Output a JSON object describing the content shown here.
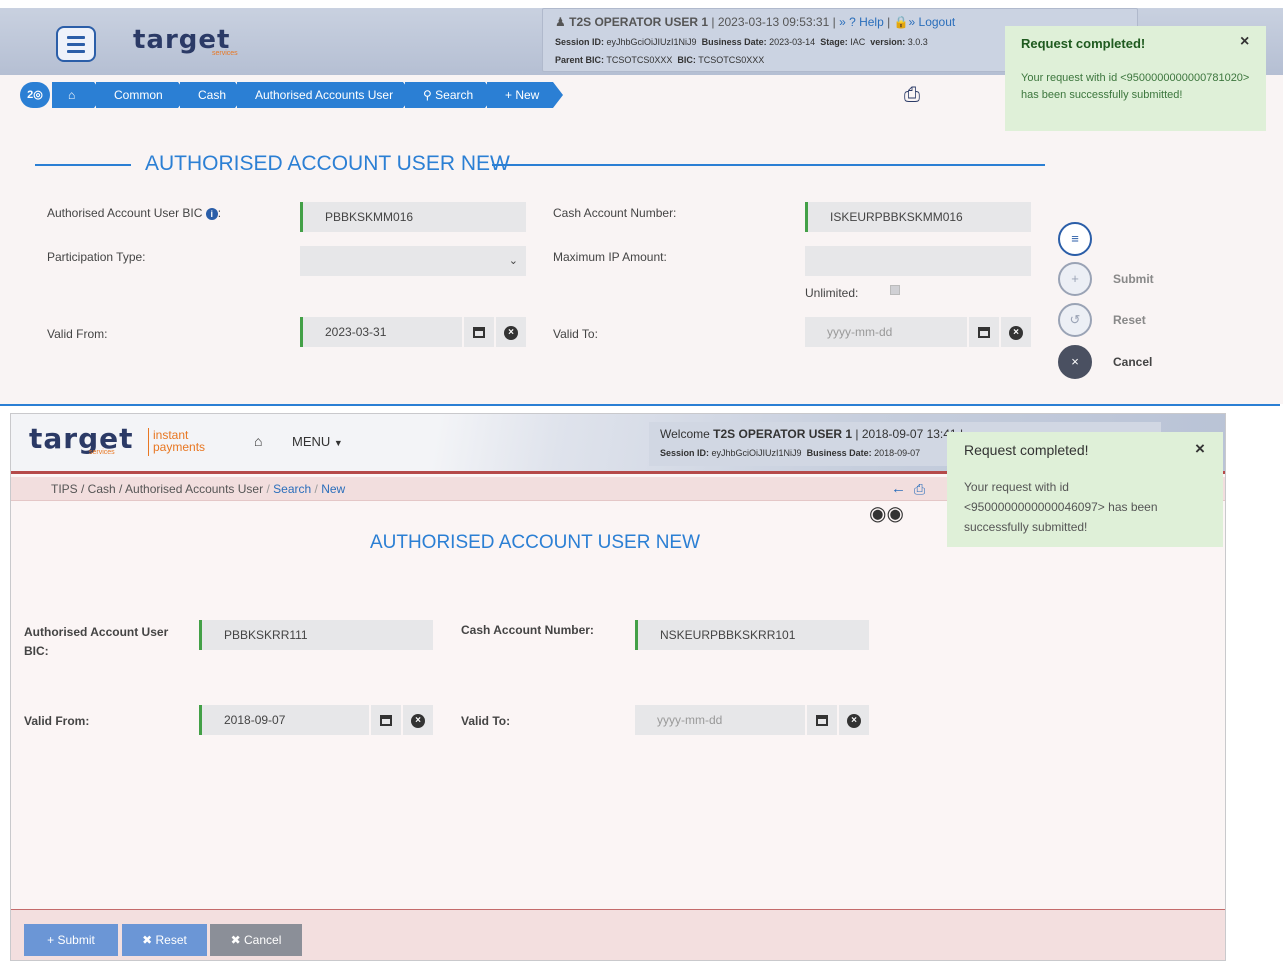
{
  "top": {
    "logo": "target",
    "logo_sub": "services",
    "user": {
      "name": "T2S OPERATOR USER 1",
      "datetime": "| 2023-03-13 09:53:31 |",
      "help_label": "» ? Help",
      "sep": "|",
      "logout_label": "» Logout",
      "session_label": "Session ID:",
      "session_value": "eyJhbGciOiJIUzI1NiJ9",
      "bizdate_label": "Business Date:",
      "bizdate_value": "2023-03-14",
      "stage_label": "Stage:",
      "stage_value": "IAC",
      "version_label": "version:",
      "version_value": "3.0.3",
      "parent_bic_label": "Parent BIC:",
      "parent_bic_value": "TCSOTCS0XXX",
      "bic_label": "BIC:",
      "bic_value": "TCSOTCS0XXX"
    },
    "breadcrumb": {
      "badge": "2",
      "items": [
        "Common",
        "Cash",
        "Authorised Accounts User",
        "Search",
        "+ New"
      ]
    },
    "title": "AUTHORISED ACCOUNT USER NEW",
    "form": {
      "bic_label": "Authorised Account User BIC",
      "bic_value": "PBBKSKMM016",
      "cash_label": "Cash Account Number:",
      "cash_value": "ISKEURPBBKSKMM016",
      "ptype_label": "Participation Type:",
      "ptype_value": "",
      "maxip_label": "Maximum IP Amount:",
      "maxip_value": "",
      "unlimited_label": "Unlimited:",
      "from_label": "Valid From:",
      "from_value": "2023-03-31",
      "to_label": "Valid To:",
      "to_placeholder": "yyyy-mm-dd"
    },
    "actions": {
      "submit": "Submit",
      "reset": "Reset",
      "cancel": "Cancel"
    },
    "toast": {
      "title": "Request completed!",
      "close": "×",
      "body": "Your request with id <9500000000000781020> has been successfully submitted!"
    }
  },
  "bottom": {
    "logo": "target",
    "logo_sub": "services",
    "logo_product_1": "instant",
    "logo_product_2": "payments",
    "menu_label": "MENU",
    "user": {
      "welcome": "Welcome",
      "name": "T2S OPERATOR USER 1",
      "datetime": "| 2018-09-07 13:41 |",
      "session_label": "Session ID:",
      "session_value": "eyJhbGciOiJIUzI1NiJ9",
      "bizdate_label": "Business Date:",
      "bizdate_value": "2018-09-07"
    },
    "breadcrumb": {
      "path": "TIPS / Cash / Authorised Accounts User",
      "sep": "/",
      "search": "Search",
      "new": "New"
    },
    "title": "AUTHORISED ACCOUNT USER NEW",
    "form": {
      "bic_label_1": "Authorised Account User",
      "bic_label_2": "BIC:",
      "bic_value": "PBBKSKRR111",
      "cash_label": "Cash Account Number:",
      "cash_value": "NSKEURPBBKSKRR101",
      "from_label": "Valid From:",
      "from_value": "2018-09-07",
      "to_label": "Valid To:",
      "to_placeholder": "yyyy-mm-dd"
    },
    "footer": {
      "submit": "+ Submit",
      "reset": "✖ Reset",
      "cancel": "✖ Cancel"
    },
    "toast": {
      "title": "Request completed!",
      "close": "×",
      "body": "Your request with id <9500000000000046097> has been successfully submitted!"
    }
  },
  "colors": {
    "accent": "#2b7fd4",
    "mandatory": "#43a047",
    "toast_bg": "#dff0d8"
  }
}
